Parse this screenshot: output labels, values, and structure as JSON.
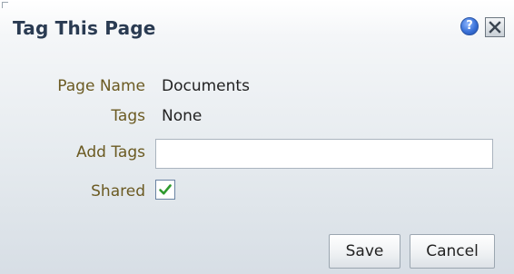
{
  "dialog": {
    "title": "Tag This Page",
    "help_icon_glyph": "?",
    "help_icon": "help-icon",
    "close_icon": "close-icon"
  },
  "form": {
    "page_name": {
      "label": "Page Name",
      "value": "Documents"
    },
    "tags": {
      "label": "Tags",
      "value": "None"
    },
    "add_tags": {
      "label": "Add Tags",
      "value": "",
      "placeholder": ""
    },
    "shared": {
      "label": "Shared",
      "checked": true
    }
  },
  "buttons": {
    "save": "Save",
    "cancel": "Cancel"
  },
  "colors": {
    "title": "#2a3b52",
    "label": "#6b5a22",
    "check": "#3aa53a"
  }
}
